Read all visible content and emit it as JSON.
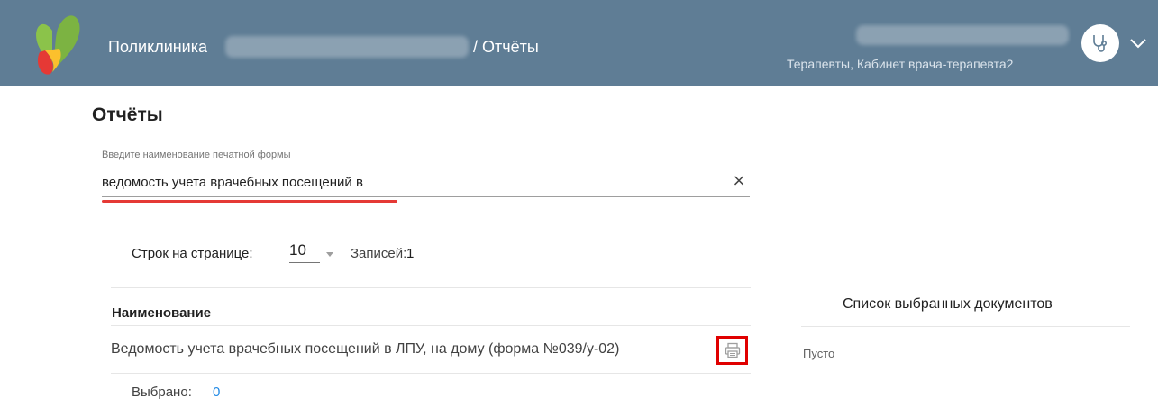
{
  "header": {
    "clinic_label": "Поликлиника",
    "section": "/ Отчёты",
    "user_role": "Терапевты, Кабинет врача-терапевта2",
    "bg_color": "#5f7d95"
  },
  "page": {
    "title": "Отчёты"
  },
  "search": {
    "label": "Введите наименование печатной формы",
    "value": "ведомость учета врачебных посещений в",
    "clear_icon": "×"
  },
  "pagination": {
    "rows_label": "Строк на странице:",
    "rows_value": "10",
    "records_label": "Записей:",
    "records_value": "1"
  },
  "table": {
    "column_name": "Наименование",
    "rows": [
      {
        "name": "Ведомость учета врачебных посещений в ЛПУ, на дому (форма №039/у-02)",
        "action_icon": "print-icon"
      }
    ]
  },
  "selection": {
    "label": "Выбрано:",
    "count": "0",
    "count_color": "#1e88e5"
  },
  "side_panel": {
    "title": "Список выбранных документов",
    "empty_text": "Пусто"
  },
  "colors": {
    "highlight": "#e00000",
    "underline_highlight": "#e53935"
  }
}
